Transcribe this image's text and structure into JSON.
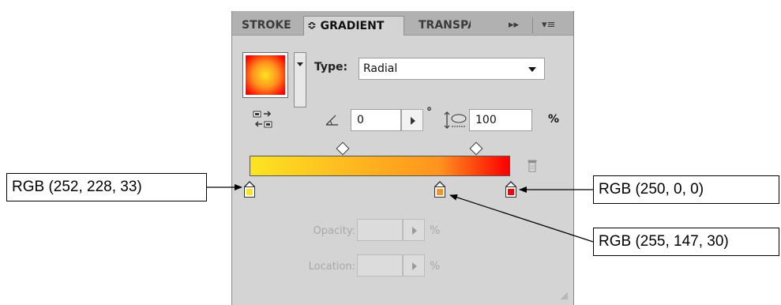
{
  "panel": {
    "tabs": [
      {
        "label": "STROKE",
        "active": false
      },
      {
        "label": "GRADIENT",
        "active": true
      },
      {
        "label": "TRANSPARENCY",
        "active": false
      }
    ],
    "active_tab_prefix": "≎",
    "tab_controls": {
      "expand": "▸▸",
      "menu": "▾≡"
    },
    "type_label": "Type:",
    "type_value": "Radial",
    "angle_value": "0",
    "degree_symbol": "°",
    "aspect_value": "100",
    "aspect_unit": "%",
    "opacity_label": "Opacity:",
    "opacity_unit": "%",
    "location_label": "Location:",
    "location_unit": "%",
    "gradient_colors": [
      "#fce421",
      "#ff931e",
      "#fa0000"
    ],
    "stop_positions_percent": [
      0,
      73,
      100
    ],
    "midpoint_positions_percent": [
      36,
      87
    ]
  },
  "callouts": {
    "left": "RGB (252, 228, 33)",
    "right_top": "RGB (250, 0, 0)",
    "right_bottom": "RGB (255, 147, 30)"
  },
  "icons": [
    "reverse-gradient-icon",
    "angle-icon",
    "aspect-ratio-icon",
    "trash-icon",
    "resize-grip-icon"
  ]
}
